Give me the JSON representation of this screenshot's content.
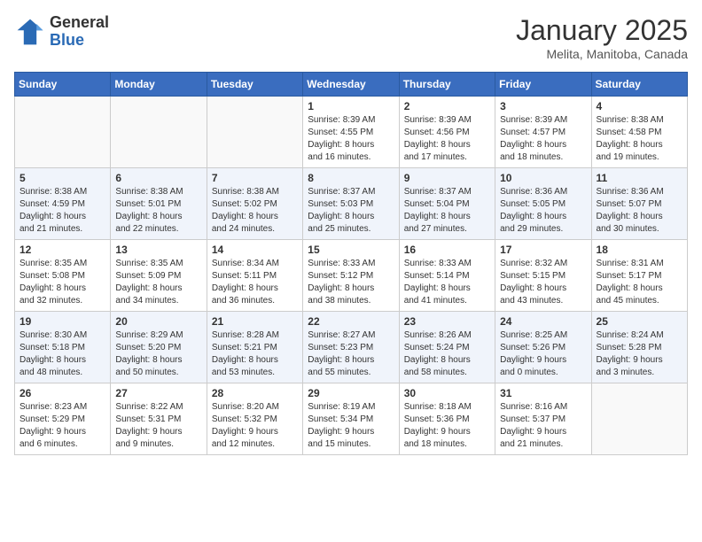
{
  "header": {
    "logo_general": "General",
    "logo_blue": "Blue",
    "month": "January 2025",
    "location": "Melita, Manitoba, Canada"
  },
  "weekdays": [
    "Sunday",
    "Monday",
    "Tuesday",
    "Wednesday",
    "Thursday",
    "Friday",
    "Saturday"
  ],
  "weeks": [
    [
      {
        "day": "",
        "content": ""
      },
      {
        "day": "",
        "content": ""
      },
      {
        "day": "",
        "content": ""
      },
      {
        "day": "1",
        "content": "Sunrise: 8:39 AM\nSunset: 4:55 PM\nDaylight: 8 hours\nand 16 minutes."
      },
      {
        "day": "2",
        "content": "Sunrise: 8:39 AM\nSunset: 4:56 PM\nDaylight: 8 hours\nand 17 minutes."
      },
      {
        "day": "3",
        "content": "Sunrise: 8:39 AM\nSunset: 4:57 PM\nDaylight: 8 hours\nand 18 minutes."
      },
      {
        "day": "4",
        "content": "Sunrise: 8:38 AM\nSunset: 4:58 PM\nDaylight: 8 hours\nand 19 minutes."
      }
    ],
    [
      {
        "day": "5",
        "content": "Sunrise: 8:38 AM\nSunset: 4:59 PM\nDaylight: 8 hours\nand 21 minutes."
      },
      {
        "day": "6",
        "content": "Sunrise: 8:38 AM\nSunset: 5:01 PM\nDaylight: 8 hours\nand 22 minutes."
      },
      {
        "day": "7",
        "content": "Sunrise: 8:38 AM\nSunset: 5:02 PM\nDaylight: 8 hours\nand 24 minutes."
      },
      {
        "day": "8",
        "content": "Sunrise: 8:37 AM\nSunset: 5:03 PM\nDaylight: 8 hours\nand 25 minutes."
      },
      {
        "day": "9",
        "content": "Sunrise: 8:37 AM\nSunset: 5:04 PM\nDaylight: 8 hours\nand 27 minutes."
      },
      {
        "day": "10",
        "content": "Sunrise: 8:36 AM\nSunset: 5:05 PM\nDaylight: 8 hours\nand 29 minutes."
      },
      {
        "day": "11",
        "content": "Sunrise: 8:36 AM\nSunset: 5:07 PM\nDaylight: 8 hours\nand 30 minutes."
      }
    ],
    [
      {
        "day": "12",
        "content": "Sunrise: 8:35 AM\nSunset: 5:08 PM\nDaylight: 8 hours\nand 32 minutes."
      },
      {
        "day": "13",
        "content": "Sunrise: 8:35 AM\nSunset: 5:09 PM\nDaylight: 8 hours\nand 34 minutes."
      },
      {
        "day": "14",
        "content": "Sunrise: 8:34 AM\nSunset: 5:11 PM\nDaylight: 8 hours\nand 36 minutes."
      },
      {
        "day": "15",
        "content": "Sunrise: 8:33 AM\nSunset: 5:12 PM\nDaylight: 8 hours\nand 38 minutes."
      },
      {
        "day": "16",
        "content": "Sunrise: 8:33 AM\nSunset: 5:14 PM\nDaylight: 8 hours\nand 41 minutes."
      },
      {
        "day": "17",
        "content": "Sunrise: 8:32 AM\nSunset: 5:15 PM\nDaylight: 8 hours\nand 43 minutes."
      },
      {
        "day": "18",
        "content": "Sunrise: 8:31 AM\nSunset: 5:17 PM\nDaylight: 8 hours\nand 45 minutes."
      }
    ],
    [
      {
        "day": "19",
        "content": "Sunrise: 8:30 AM\nSunset: 5:18 PM\nDaylight: 8 hours\nand 48 minutes."
      },
      {
        "day": "20",
        "content": "Sunrise: 8:29 AM\nSunset: 5:20 PM\nDaylight: 8 hours\nand 50 minutes."
      },
      {
        "day": "21",
        "content": "Sunrise: 8:28 AM\nSunset: 5:21 PM\nDaylight: 8 hours\nand 53 minutes."
      },
      {
        "day": "22",
        "content": "Sunrise: 8:27 AM\nSunset: 5:23 PM\nDaylight: 8 hours\nand 55 minutes."
      },
      {
        "day": "23",
        "content": "Sunrise: 8:26 AM\nSunset: 5:24 PM\nDaylight: 8 hours\nand 58 minutes."
      },
      {
        "day": "24",
        "content": "Sunrise: 8:25 AM\nSunset: 5:26 PM\nDaylight: 9 hours\nand 0 minutes."
      },
      {
        "day": "25",
        "content": "Sunrise: 8:24 AM\nSunset: 5:28 PM\nDaylight: 9 hours\nand 3 minutes."
      }
    ],
    [
      {
        "day": "26",
        "content": "Sunrise: 8:23 AM\nSunset: 5:29 PM\nDaylight: 9 hours\nand 6 minutes."
      },
      {
        "day": "27",
        "content": "Sunrise: 8:22 AM\nSunset: 5:31 PM\nDaylight: 9 hours\nand 9 minutes."
      },
      {
        "day": "28",
        "content": "Sunrise: 8:20 AM\nSunset: 5:32 PM\nDaylight: 9 hours\nand 12 minutes."
      },
      {
        "day": "29",
        "content": "Sunrise: 8:19 AM\nSunset: 5:34 PM\nDaylight: 9 hours\nand 15 minutes."
      },
      {
        "day": "30",
        "content": "Sunrise: 8:18 AM\nSunset: 5:36 PM\nDaylight: 9 hours\nand 18 minutes."
      },
      {
        "day": "31",
        "content": "Sunrise: 8:16 AM\nSunset: 5:37 PM\nDaylight: 9 hours\nand 21 minutes."
      },
      {
        "day": "",
        "content": ""
      }
    ]
  ]
}
